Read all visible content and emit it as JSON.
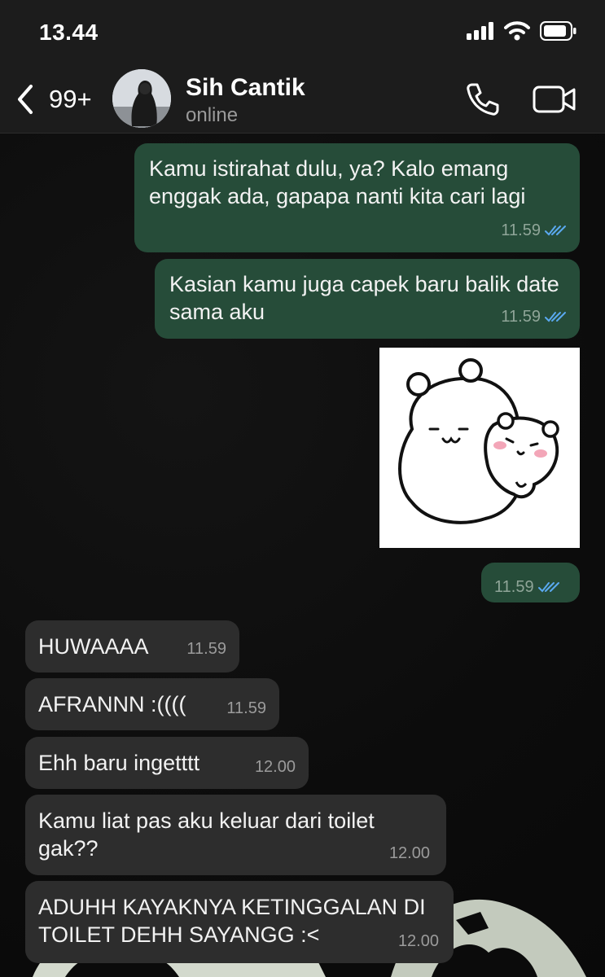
{
  "status_bar": {
    "time": "13.44"
  },
  "header": {
    "unread_count": "99+",
    "contact_name": "Sih Cantik",
    "contact_status": "online"
  },
  "messages": [
    {
      "direction": "outgoing",
      "text": "Kamu istirahat dulu, ya? Kalo emang enggak ada, gapapa nanti kita cari lagi",
      "time": "11.59",
      "read": true
    },
    {
      "direction": "outgoing",
      "text": "Kasian kamu juga capek baru balik date sama aku",
      "time": "11.59",
      "read": true
    },
    {
      "direction": "outgoing",
      "type": "sticker",
      "sticker": "hugging-bears",
      "time": "11.59",
      "read": true
    },
    {
      "direction": "incoming",
      "text": "HUWAAAA",
      "time": "11.59"
    },
    {
      "direction": "incoming",
      "text": "AFRANNN :((((",
      "time": "11.59"
    },
    {
      "direction": "incoming",
      "text": "Ehh baru ingetttt",
      "time": "12.00"
    },
    {
      "direction": "incoming",
      "text": "Kamu liat pas aku keluar dari toilet gak??",
      "time": "12.00"
    },
    {
      "direction": "incoming",
      "text": "ADUHH KAYAKNYA KETINGGALAN DI TOILET DEHH SAYANGG :<",
      "time": "12.00"
    }
  ],
  "colors": {
    "outgoing_bubble": "#264c39",
    "incoming_bubble": "#2d2d2d",
    "read_ticks": "#5aa9f0",
    "header_bg": "#1c1c1c"
  }
}
